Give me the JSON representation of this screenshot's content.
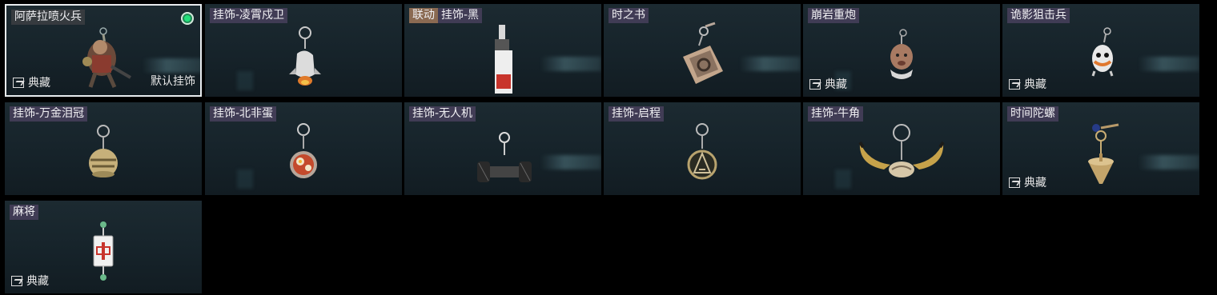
{
  "cards": [
    {
      "name": "阿萨拉喷火兵",
      "collection": "典藏",
      "default_label": "默认挂饰",
      "selected": true,
      "icon": "flamethrower-soldier-charm"
    },
    {
      "name": "挂饰-凌霄戍卫",
      "icon": "rocket-charm"
    },
    {
      "tag": "联动",
      "name": "挂饰-黑",
      "icon": "bottle-charm"
    },
    {
      "name": "时之书",
      "icon": "book-charm"
    },
    {
      "name": "崩岩重炮",
      "collection": "典藏",
      "icon": "creature-charm"
    },
    {
      "name": "诡影狙击兵",
      "collection": "典藏",
      "icon": "ghost-charm"
    },
    {
      "name": "挂饰-万金泪冠",
      "icon": "crown-charm"
    },
    {
      "name": "挂饰-北非蛋",
      "icon": "egg-dish-charm"
    },
    {
      "name": "挂饰-无人机",
      "icon": "drone-charm"
    },
    {
      "name": "挂饰-启程",
      "icon": "compass-charm"
    },
    {
      "name": "挂饰-牛角",
      "icon": "horn-charm"
    },
    {
      "name": "时间陀螺",
      "collection": "典藏",
      "icon": "spinning-top-charm"
    },
    {
      "name": "麻将",
      "collection": "典藏",
      "icon": "mahjong-charm"
    }
  ]
}
